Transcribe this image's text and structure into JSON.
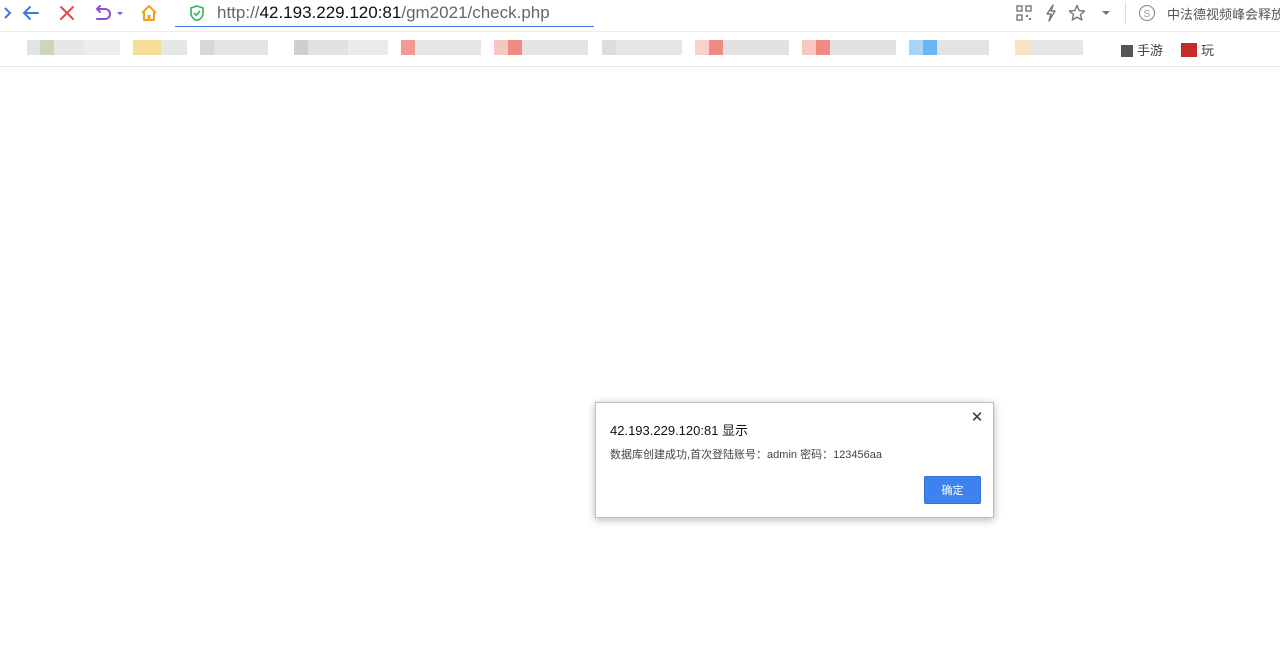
{
  "browser": {
    "address_bar": {
      "protocol": "http://",
      "host": "42.193.229.120:81",
      "path": "/gm2021/check.php"
    },
    "toolbar_icons": [
      "back-arrow-icon",
      "stop-icon",
      "undo-icon",
      "home-icon"
    ],
    "right_icons": [
      "qr-code-icon",
      "lightning-icon",
      "star-icon",
      "dropdown-icon",
      "search-engine-icon"
    ],
    "news_ticker": "中法德视频峰会释放",
    "bookmarks_tail": {
      "item1": "手游",
      "item2": "玩"
    }
  },
  "dialog": {
    "title": "42.193.229.120:81 显示",
    "message": "数据库创建成功,首次登陆账号：admin 密码：123456aa",
    "ok_label": "确定",
    "close_symbol": "✕"
  },
  "colors": {
    "accent": "#3e82f0",
    "back_icon": "#3b7be0",
    "stop_icon": "#e24b4b",
    "undo_icon": "#8a4fd6",
    "home_icon": "#f0a11c",
    "shield_icon": "#2fb55a"
  }
}
